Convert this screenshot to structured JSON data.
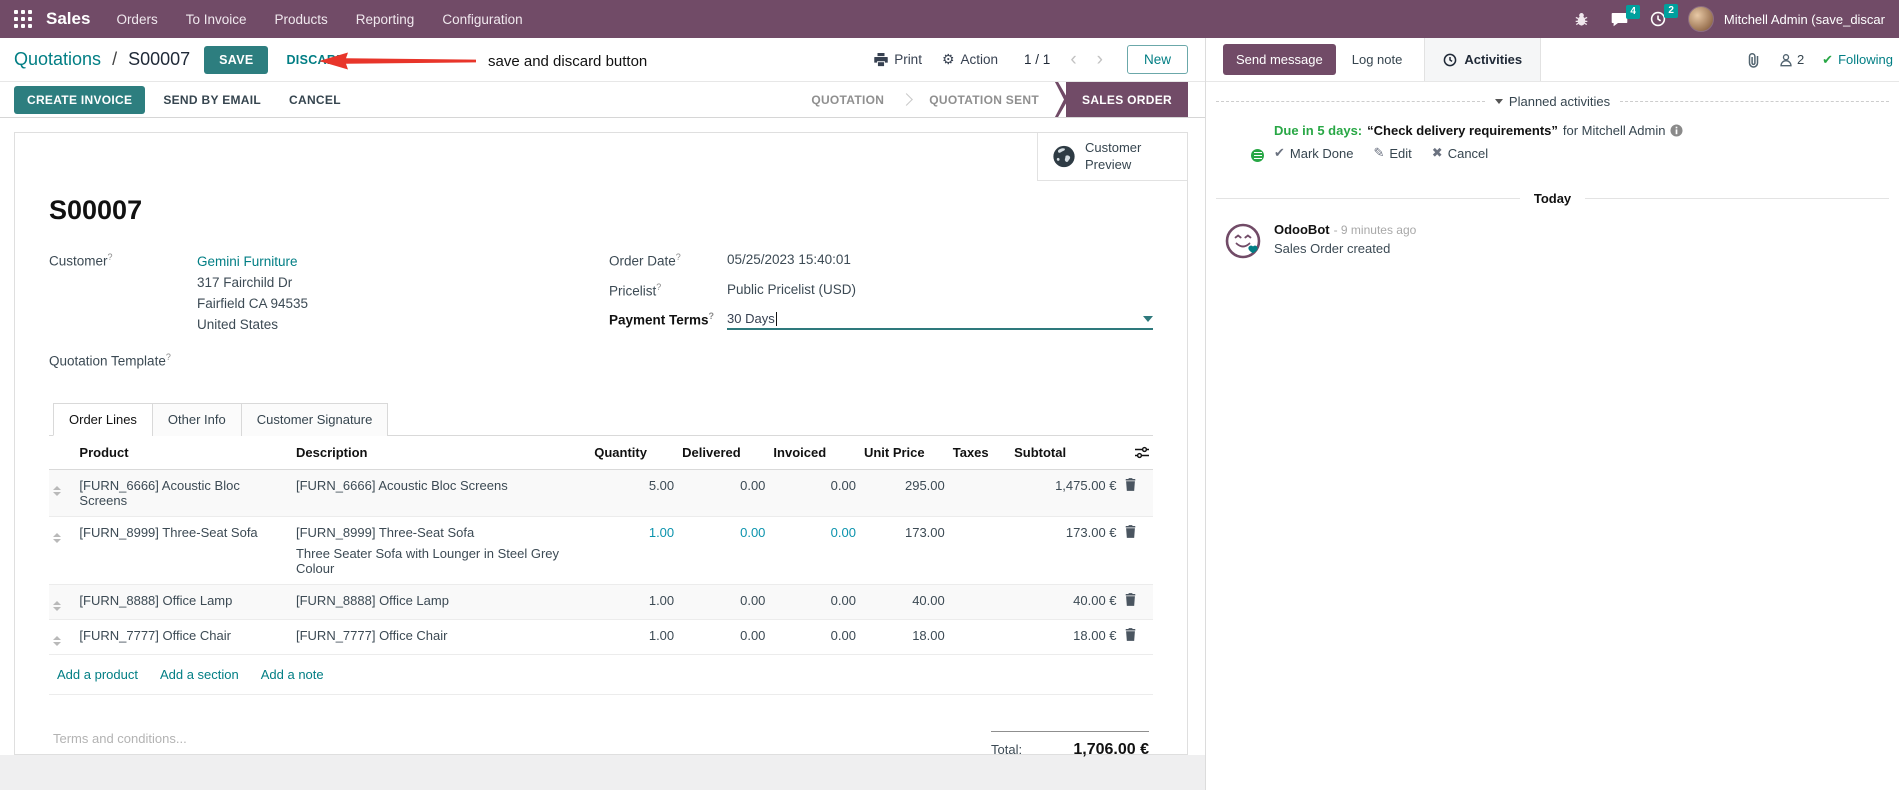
{
  "glyphs": {
    "help": "?",
    "gear": "⚙",
    "check": "✔",
    "x": "✖",
    "pencil": "✎",
    "chev_left": "‹",
    "chev_right": "›"
  },
  "navbar": {
    "app_name": "Sales",
    "menus": [
      "Orders",
      "To Invoice",
      "Products",
      "Reporting",
      "Configuration"
    ],
    "message_badge": "4",
    "activity_badge": "2",
    "user_name": "Mitchell Admin (save_discar"
  },
  "control_panel": {
    "breadcrumb_parent": "Quotations",
    "breadcrumb_sep": "/",
    "breadcrumb_current": "S00007",
    "save_label": "SAVE",
    "discard_label": "DISCARD",
    "annotation_text": "save and discard button",
    "print_label": "Print",
    "action_label": "Action",
    "pager": "1 / 1",
    "new_label": "New"
  },
  "statusbar": {
    "buttons": {
      "create_invoice": "CREATE INVOICE",
      "send_by_email": "SEND BY EMAIL",
      "cancel": "CANCEL"
    },
    "states": [
      {
        "label": "QUOTATION",
        "active": false
      },
      {
        "label": "QUOTATION SENT",
        "active": false
      },
      {
        "label": "SALES ORDER",
        "active": true
      }
    ]
  },
  "form": {
    "customer_preview": "Customer Preview",
    "name": "S00007",
    "customer_label": "Customer",
    "customer_name": "Gemini Furniture",
    "customer_address": [
      "317 Fairchild Dr",
      "Fairfield CA 94535",
      "United States"
    ],
    "quotation_template_label": "Quotation Template",
    "order_date_label": "Order Date",
    "order_date": "05/25/2023 15:40:01",
    "pricelist_label": "Pricelist",
    "pricelist": "Public Pricelist (USD)",
    "payment_terms_label": "Payment Terms",
    "payment_terms": "30 Days",
    "tabs": [
      "Order Lines",
      "Other Info",
      "Customer Signature"
    ],
    "table": {
      "headers": [
        "Product",
        "Description",
        "Quantity",
        "Delivered",
        "Invoiced",
        "Unit Price",
        "Taxes",
        "Subtotal"
      ],
      "rows": [
        {
          "product": "[FURN_6666] Acoustic Bloc Screens",
          "description": "[FURN_6666] Acoustic Bloc Screens",
          "description2": "",
          "quantity": "5.00",
          "delivered": "0.00",
          "invoiced": "0.00",
          "unit_price": "295.00",
          "taxes": "",
          "subtotal": "1,475.00 €"
        },
        {
          "product": "[FURN_8999] Three-Seat Sofa",
          "description": "[FURN_8999] Three-Seat Sofa",
          "description2": "Three Seater Sofa with Lounger in Steel Grey Colour",
          "quantity": "1.00",
          "delivered": "0.00",
          "invoiced": "0.00",
          "unit_price": "173.00",
          "taxes": "",
          "subtotal": "173.00 €"
        },
        {
          "product": "[FURN_8888] Office Lamp",
          "description": "[FURN_8888] Office Lamp",
          "description2": "",
          "quantity": "1.00",
          "delivered": "0.00",
          "invoiced": "0.00",
          "unit_price": "40.00",
          "taxes": "",
          "subtotal": "40.00 €"
        },
        {
          "product": "[FURN_7777] Office Chair",
          "description": "[FURN_7777] Office Chair",
          "description2": "",
          "quantity": "1.00",
          "delivered": "0.00",
          "invoiced": "0.00",
          "unit_price": "18.00",
          "taxes": "",
          "subtotal": "18.00 €"
        }
      ],
      "links": {
        "add_product": "Add a product",
        "add_section": "Add a section",
        "add_note": "Add a note"
      }
    },
    "terms_placeholder": "Terms and conditions...",
    "total_label": "Total:",
    "total_value": "1,706.00 €"
  },
  "chatter": {
    "send_message": "Send message",
    "log_note": "Log note",
    "activities": "Activities",
    "followers_count": "2",
    "following": "Following",
    "planned_title": "Planned activities",
    "activity": {
      "due": "Due in 5 days:",
      "title": "“Check delivery requirements”",
      "assignee": "for Mitchell Admin",
      "mark_done": "Mark Done",
      "edit": "Edit",
      "cancel": "Cancel"
    },
    "today_label": "Today",
    "message": {
      "author": "OdooBot",
      "time": "- 9 minutes ago",
      "body": "Sales Order created"
    }
  }
}
